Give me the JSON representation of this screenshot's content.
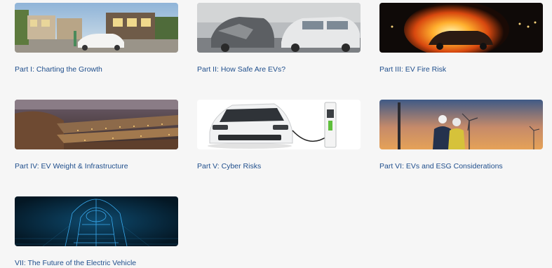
{
  "parts": [
    {
      "label": "Part I: Charting the Growth",
      "image": "suburban-house-ev-charging-photo"
    },
    {
      "label": "Part II: How Safe Are EVs?",
      "image": "crashed-cars-photo"
    },
    {
      "label": "Part III: EV Fire Risk",
      "image": "burning-car-photo"
    },
    {
      "label": "Part IV: EV Weight & Infrastructure",
      "image": "aerial-parking-lot-night-photo"
    },
    {
      "label": "Part V: Cyber Risks",
      "image": "white-ev-charger-photo"
    },
    {
      "label": "Part VI: EVs and ESG Considerations",
      "image": "engineers-wind-turbines-photo"
    },
    {
      "label": "VII: The Future of the Electric Vehicle",
      "image": "wireframe-car-hologram-photo"
    }
  ],
  "colors": {
    "link": "#1f4e8c",
    "background": "#f6f6f6"
  }
}
